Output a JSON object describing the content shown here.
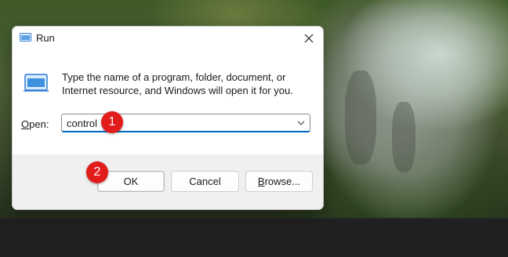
{
  "dialog": {
    "title": "Run",
    "title_icon": "run-icon",
    "description": "Type the name of a program, folder, document, or Internet resource, and Windows will open it for you.",
    "open_label_accel": "O",
    "open_label_rest": "pen:",
    "input_value": "control",
    "buttons": {
      "ok": "OK",
      "cancel": "Cancel",
      "browse_accel": "B",
      "browse_rest": "rowse..."
    }
  },
  "markers": {
    "step1": "1",
    "step2": "2"
  },
  "colors": {
    "marker": "#e21b1b",
    "input_focus": "#0067c0",
    "taskbar": "#202020"
  }
}
